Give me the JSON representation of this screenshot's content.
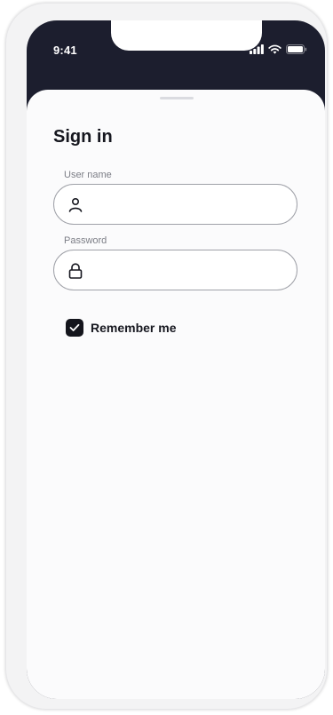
{
  "status_bar": {
    "time": "9:41"
  },
  "sheet": {
    "title": "Sign in"
  },
  "username": {
    "label": "User name",
    "value": "",
    "icon": "user-icon"
  },
  "password": {
    "label": "Password",
    "value": "",
    "icon": "lock-icon"
  },
  "remember": {
    "label": "Remember me",
    "checked": true
  },
  "colors": {
    "header_bg": "#1c1e2e",
    "sheet_bg": "#fbfbfc",
    "text": "#16171f",
    "checkbox": "#14151c",
    "field_border": "#9fa1a8"
  }
}
